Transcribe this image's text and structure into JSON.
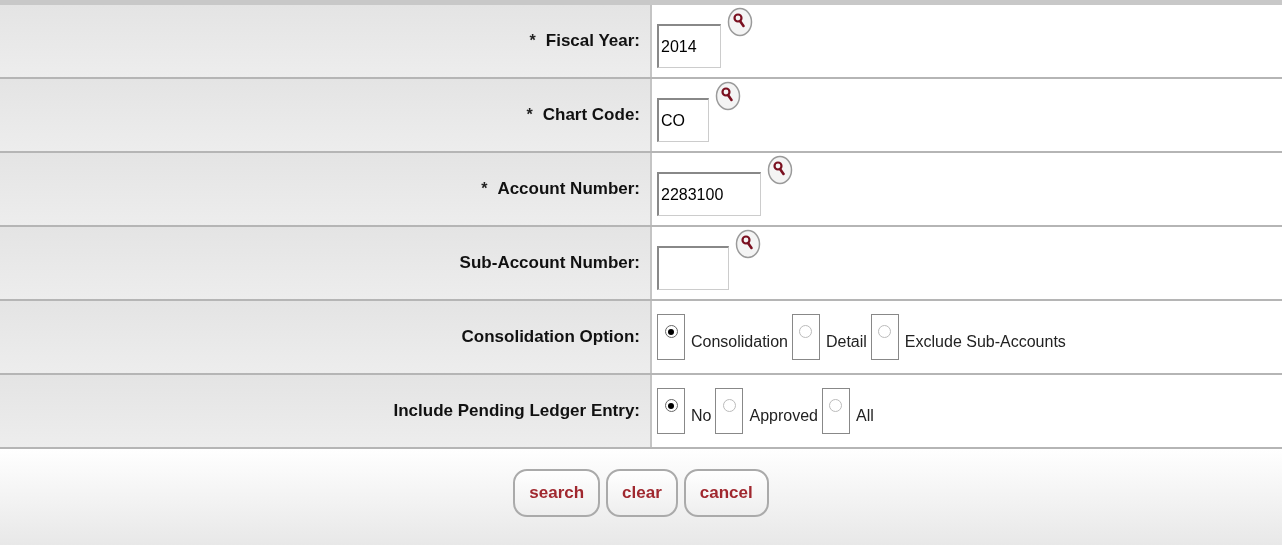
{
  "fields": [
    {
      "kind": "text",
      "label": "Fiscal Year:",
      "required": true,
      "value": "2014"
    },
    {
      "kind": "text",
      "label": "Chart Code:",
      "required": true,
      "value": "CO"
    },
    {
      "kind": "text",
      "label": "Account Number:",
      "required": true,
      "value": "2283100"
    },
    {
      "kind": "text",
      "label": "Sub-Account Number:",
      "required": false
    },
    {
      "kind": "radio",
      "label": "Consolidation Option:",
      "options": [
        {
          "label": "Consolidation",
          "selected": true
        },
        {
          "label": "Detail",
          "selected": false
        },
        {
          "label": "Exclude Sub-Accounts",
          "selected": false
        }
      ]
    },
    {
      "kind": "radio",
      "label": "Include Pending Ledger Entry:",
      "options": [
        {
          "label": "No",
          "selected": true
        },
        {
          "label": "Approved",
          "selected": false
        },
        {
          "label": "All",
          "selected": false
        }
      ]
    }
  ],
  "required_mark": "*",
  "buttons": [
    "search",
    "clear",
    "cancel"
  ]
}
